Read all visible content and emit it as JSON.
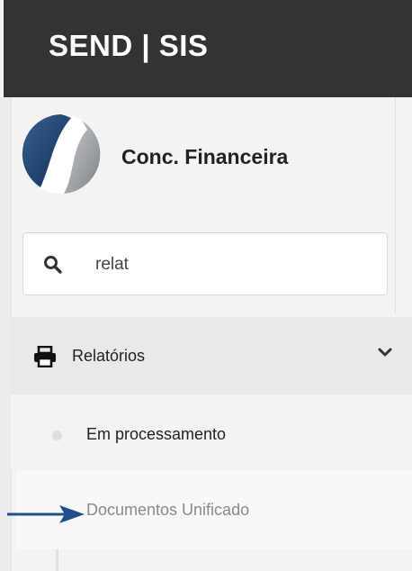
{
  "header": {
    "brand": "SEND | SIS"
  },
  "profile": {
    "company": "Conc. Financeira"
  },
  "search": {
    "value": "relat"
  },
  "menu": {
    "section_label": "Relatórios",
    "items": [
      {
        "label": "Em processamento"
      },
      {
        "label": "Documentos Unificado"
      }
    ]
  },
  "colors": {
    "topbar": "#333333",
    "sidebar_bg": "#f3f3f3",
    "section_bg": "#e9e9e9",
    "annotation_arrow": "#1f4e8c"
  },
  "icons": [
    "search-icon",
    "printer-icon",
    "chevron-down-icon",
    "company-logo",
    "annotation-arrow"
  ]
}
